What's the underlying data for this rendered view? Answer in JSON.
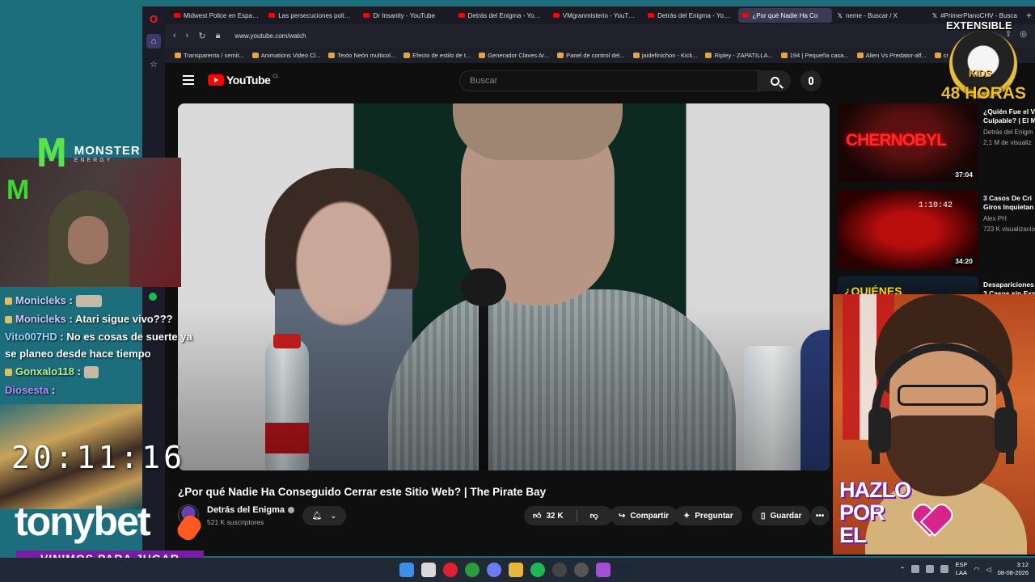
{
  "browser": {
    "tabs": [
      {
        "title": "Midwest Police en Españo",
        "icon": "youtube-icon"
      },
      {
        "title": "Las persecuciones policial",
        "icon": "youtube-icon"
      },
      {
        "title": "Dr Insanity - YouTube",
        "icon": "youtube-icon"
      },
      {
        "title": "Detrás del Enigma - YouTu",
        "icon": "youtube-icon"
      },
      {
        "title": "VMgranmisterio - YouTube",
        "icon": "youtube-icon"
      },
      {
        "title": "Detrás del Enigma - YouTu",
        "icon": "youtube-icon"
      },
      {
        "title": "¿Por qué Nadie Ha Co",
        "icon": "youtube-icon",
        "active": true
      },
      {
        "title": "neme - Buscar / X",
        "icon": "x-icon"
      },
      {
        "title": "#PrimerPlanoCHV - Busca",
        "icon": "x-icon"
      }
    ],
    "url": "www.youtube.com/watch",
    "bookmarks": [
      "Transparenta / semit...",
      "Animations Video Cl...",
      "Texto Neón multicol...",
      "Efecto de estilo de t...",
      "Generador Claves Ar...",
      "Panel de control del...",
      "jaidefinichon - Kick...",
      "Ripley - ZAPATILLA...",
      "194 | Pequeña casa...",
      "Alien Vs Predator-alf...",
      "cr"
    ]
  },
  "youtube": {
    "logo_text": "YouTube",
    "logo_region": "CL",
    "search_placeholder": "Buscar",
    "video_title": "¿Por qué Nadie Ha Conseguido Cerrar este Sitio Web? | The Pirate Bay",
    "channel_name": "Detrás del Enigma",
    "subscribers": "521 K suscriptores",
    "likes": "32 K",
    "share_label": "Compartir",
    "ask_label": "Preguntar",
    "save_label": "Guardar",
    "more_label": "•••"
  },
  "recommendations": [
    {
      "title": "¿Quién Fue el V",
      "title2": "Culpable? | El M",
      "channel": "Detrás del Enigm",
      "views": "2,1 M de visualiz",
      "duration": "37:04",
      "thumb_text": "CHERNOBYL"
    },
    {
      "title": "3 Casos De Cri",
      "title2": "Giros Inquietan",
      "channel": "Alex PH",
      "views": "723 K visualizacio",
      "duration": "34:20",
      "thumb_text": "1:10:42"
    },
    {
      "title": "Desapariciones",
      "title2": "3 Casos sin Exp",
      "channel": "",
      "views": "",
      "duration": "",
      "thumb_text": "¿QUIÉNES"
    }
  ],
  "stream": {
    "sponsor_brand": "MONSTER",
    "sponsor_sub": "ENERGY",
    "chat": [
      {
        "user": "Monicleks",
        "message": ":",
        "emote": true,
        "color": "#d0c8ff"
      },
      {
        "user": "Monicleks",
        "message": ": Atari sigue vivo???",
        "emote": false,
        "color": "#d0c8ff"
      },
      {
        "user": "Vito007HD",
        "message": ": No es cosas de suerte ya se planeo desde hace tiempo",
        "emote": false,
        "color": "#9ad7ff"
      },
      {
        "user": "Gonxalo118",
        "message": ":",
        "emote": true,
        "color": "#b8f28a"
      },
      {
        "user": "Diosesta",
        "message": ":",
        "emote": true,
        "color": "#b48aff"
      }
    ],
    "clock": "20:11:16",
    "casino_brand": "tonybet",
    "casino_tagline": "VINIMOS PARA JUGAR",
    "badge_top": "EXTENSIBLE",
    "badge_mid": "KIDS",
    "badge_bottom": "48 HORAS",
    "cta": "HAZLO\nPOR\nEL"
  },
  "taskbar": {
    "lang": "ESP",
    "lang2": "LAA",
    "time": "3:12",
    "date": "08-08-2026"
  }
}
